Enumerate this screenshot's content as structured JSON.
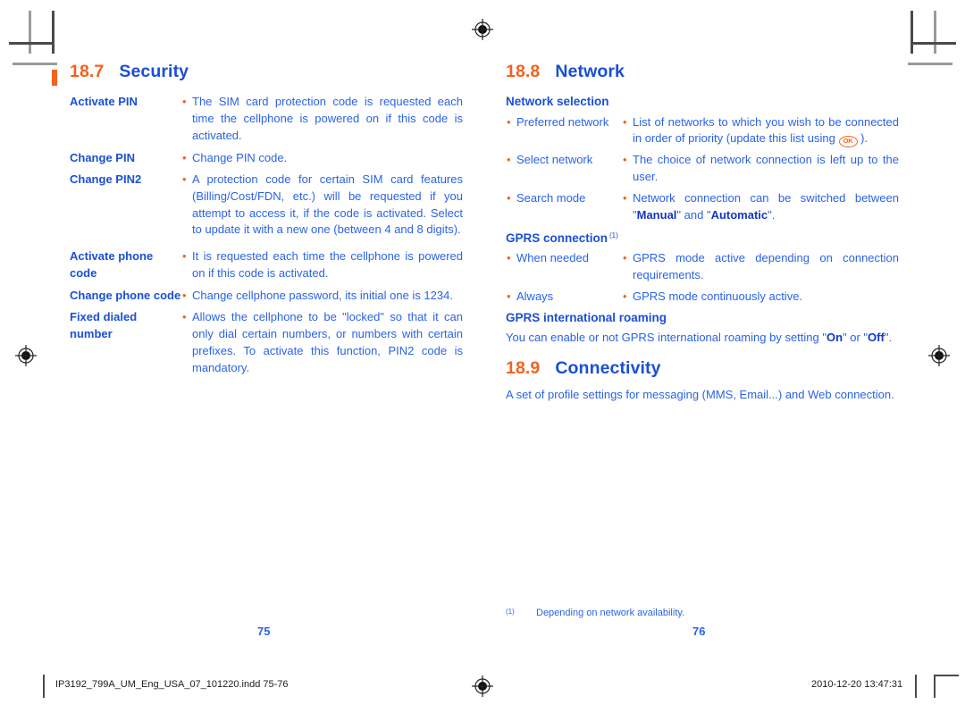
{
  "document": {
    "colors": {
      "accent_orange": "#f4621f",
      "heading_blue": "#1a4fd6",
      "body_blue": "#2a63e8"
    }
  },
  "left_page": {
    "section": {
      "number": "18.7",
      "title": "Security"
    },
    "entries": [
      {
        "label": "Activate PIN",
        "bullet": "•",
        "description": "The SIM card protection code is requested each time the cellphone is powered on if this code is activated."
      },
      {
        "label": "Change PIN",
        "bullet": "•",
        "description": "Change PIN code."
      },
      {
        "label": "Change PIN2",
        "bullet": "•",
        "description": "A protection code for certain SIM card features (Billing/Cost/FDN, etc.) will be requested if you attempt to access it, if the code is activated. Select to update it with a new one (between 4 and 8 digits)."
      },
      {
        "label": "Activate phone code",
        "bullet": "•",
        "description": "It is requested each time the cellphone is powered on if this code is activated."
      },
      {
        "label": "Change phone code",
        "bullet": "•",
        "description": "Change cellphone password, its initial one is 1234."
      },
      {
        "label": "Fixed dialed number",
        "bullet": "•",
        "description": "Allows the cellphone to be \"locked\" so that it can only dial certain numbers, or numbers with certain prefixes. To activate this function, PIN2 code is mandatory."
      }
    ],
    "folio": "75"
  },
  "right_page": {
    "section_network": {
      "number": "18.8",
      "title": "Network"
    },
    "network_selection": {
      "heading": "Network selection",
      "rows": [
        {
          "bullet": "•",
          "term": "Preferred network",
          "explanation_before_icon": "List of networks to which you wish to be connected in order of priority (update this list using ",
          "icon_label": "OK",
          "explanation_after_icon": " )."
        },
        {
          "bullet": "•",
          "term": "Select network",
          "explanation": "The choice of network connection is left up to the user."
        },
        {
          "bullet": "•",
          "term": "Search mode",
          "explanation_prefix": "Network connection can be switched between \"",
          "explanation_bold_1": "Manual",
          "explanation_middle": "\" and \"",
          "explanation_bold_2": "Automatic",
          "explanation_suffix": "\"."
        }
      ]
    },
    "gprs_connection": {
      "heading": "GPRS connection",
      "footnote_mark": "(1)",
      "rows": [
        {
          "bullet": "•",
          "term": "When needed",
          "explanation": "GPRS mode active depending on connection requirements."
        },
        {
          "bullet": "•",
          "term": "Always",
          "explanation": "GPRS mode continuously active."
        }
      ]
    },
    "gprs_roaming": {
      "heading": "GPRS international roaming",
      "text_prefix": "You can enable or not GPRS international roaming by setting \"",
      "bold_1": "On",
      "text_middle": "\" or \"",
      "bold_2": "Off",
      "text_suffix": "\"."
    },
    "section_connectivity": {
      "number": "18.9",
      "title": "Connectivity",
      "body": "A set of profile settings for messaging (MMS, Email...) and Web connection."
    },
    "footnote": {
      "mark": "(1)",
      "text": "Depending on network availability."
    },
    "folio": "76"
  },
  "print_slug": {
    "filename": "IP3192_799A_UM_Eng_USA_07_101220.indd   75-76",
    "datetime": "2010-12-20   13:47:31"
  }
}
